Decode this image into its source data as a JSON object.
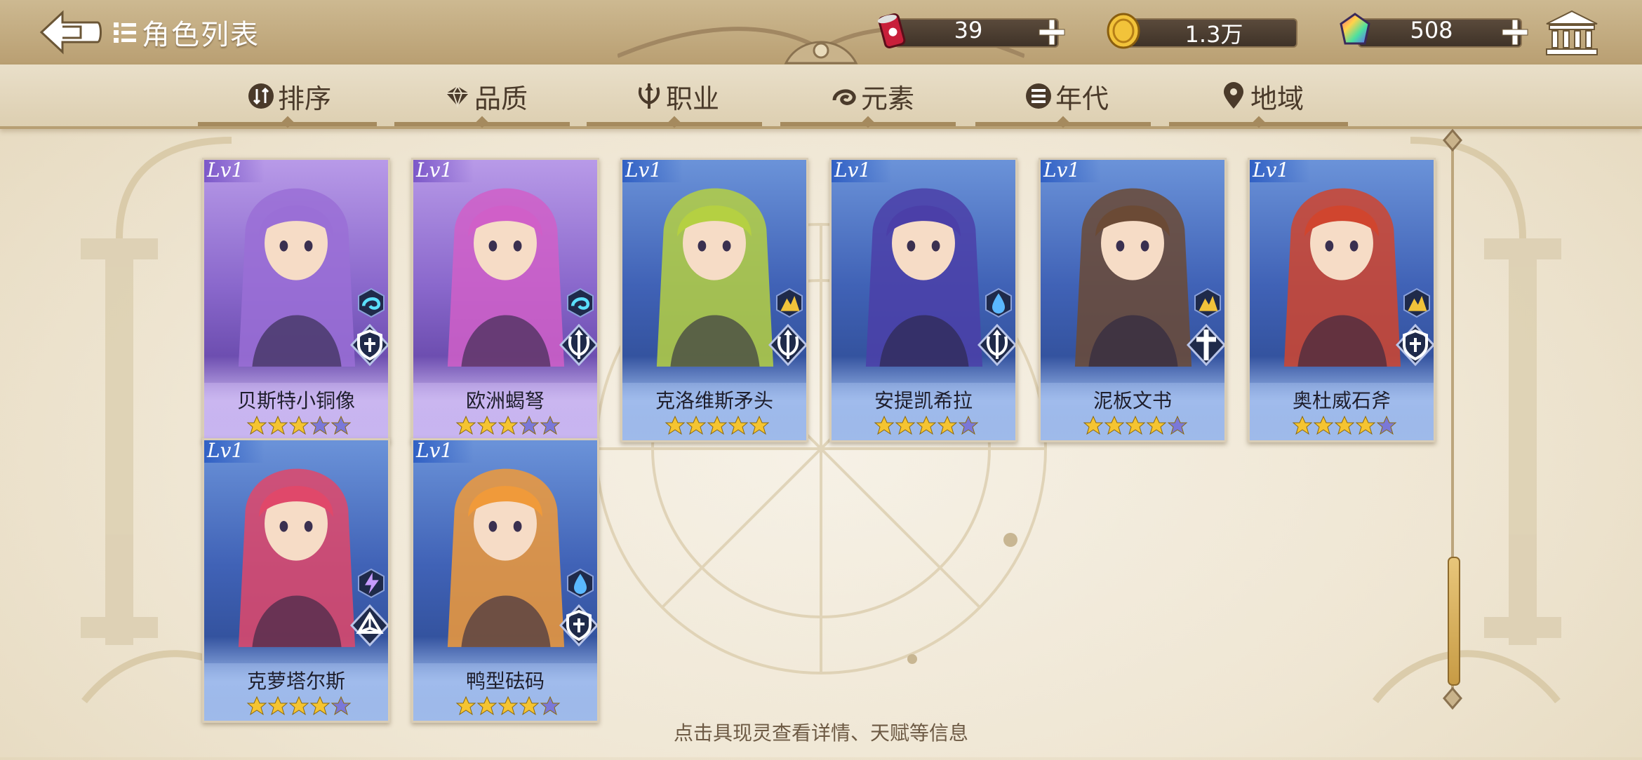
{
  "header": {
    "title": "角色列表",
    "back_icon": "back-arrow-icon",
    "list_icon": "list-icon",
    "museum_icon": "museum-icon"
  },
  "resources": [
    {
      "name": "energy-can",
      "icon": "can-icon",
      "value": "39",
      "has_plus": true
    },
    {
      "name": "gold-coin",
      "icon": "coin-icon",
      "value": "1.3万",
      "has_plus": false
    },
    {
      "name": "gem",
      "icon": "rainbow-gem-icon",
      "value": "508",
      "has_plus": true
    }
  ],
  "tabs": [
    {
      "label": "排序",
      "icon": "sort-icon"
    },
    {
      "label": "品质",
      "icon": "quality-icon"
    },
    {
      "label": "职业",
      "icon": "class-icon"
    },
    {
      "label": "元素",
      "icon": "element-icon"
    },
    {
      "label": "年代",
      "icon": "era-icon"
    },
    {
      "label": "地域",
      "icon": "location-pin-icon"
    }
  ],
  "cards": [
    {
      "level": "Lv1",
      "name": "贝斯特小铜像",
      "stars": 3,
      "max_stars": 5,
      "rarity": "purple",
      "element_icon": "wind-icon",
      "class_icon": "shield-icon",
      "accent": "#9a6fd6"
    },
    {
      "level": "Lv1",
      "name": "欧洲蝎弩",
      "stars": 3,
      "max_stars": 5,
      "rarity": "purple",
      "element_icon": "wind-icon",
      "class_icon": "bow-icon",
      "accent": "#d05fc8"
    },
    {
      "level": "Lv1",
      "name": "克洛维斯矛头",
      "stars": 5,
      "max_stars": 5,
      "rarity": "blue",
      "element_icon": "earth-icon",
      "class_icon": "bow-icon",
      "accent": "#b5d042"
    },
    {
      "level": "Lv1",
      "name": "安提凯希拉",
      "stars": 4,
      "max_stars": 5,
      "rarity": "blue",
      "element_icon": "water-icon",
      "class_icon": "bow-icon",
      "accent": "#4b3fa8"
    },
    {
      "level": "Lv1",
      "name": "泥板文书",
      "stars": 4,
      "max_stars": 5,
      "rarity": "blue",
      "element_icon": "earth-icon",
      "class_icon": "cross-icon",
      "accent": "#6b4a35"
    },
    {
      "level": "Lv1",
      "name": "奥杜威石斧",
      "stars": 4,
      "max_stars": 5,
      "rarity": "blue",
      "element_icon": "earth-icon",
      "class_icon": "shield-icon",
      "accent": "#d0452e"
    },
    {
      "level": "Lv1",
      "name": "克萝塔尔斯",
      "stars": 4,
      "max_stars": 5,
      "rarity": "blue",
      "element_icon": "thunder-icon",
      "class_icon": "book-icon",
      "accent": "#e0486a"
    },
    {
      "level": "Lv1",
      "name": "鸭型砝码",
      "stars": 4,
      "max_stars": 5,
      "rarity": "blue",
      "element_icon": "water-icon",
      "class_icon": "shield-icon",
      "accent": "#f09a3a"
    }
  ],
  "hint": "点击具现灵查看详情、天赋等信息",
  "colors": {
    "gold_star": "#f5c431",
    "empty_star": "#7a78d8"
  }
}
